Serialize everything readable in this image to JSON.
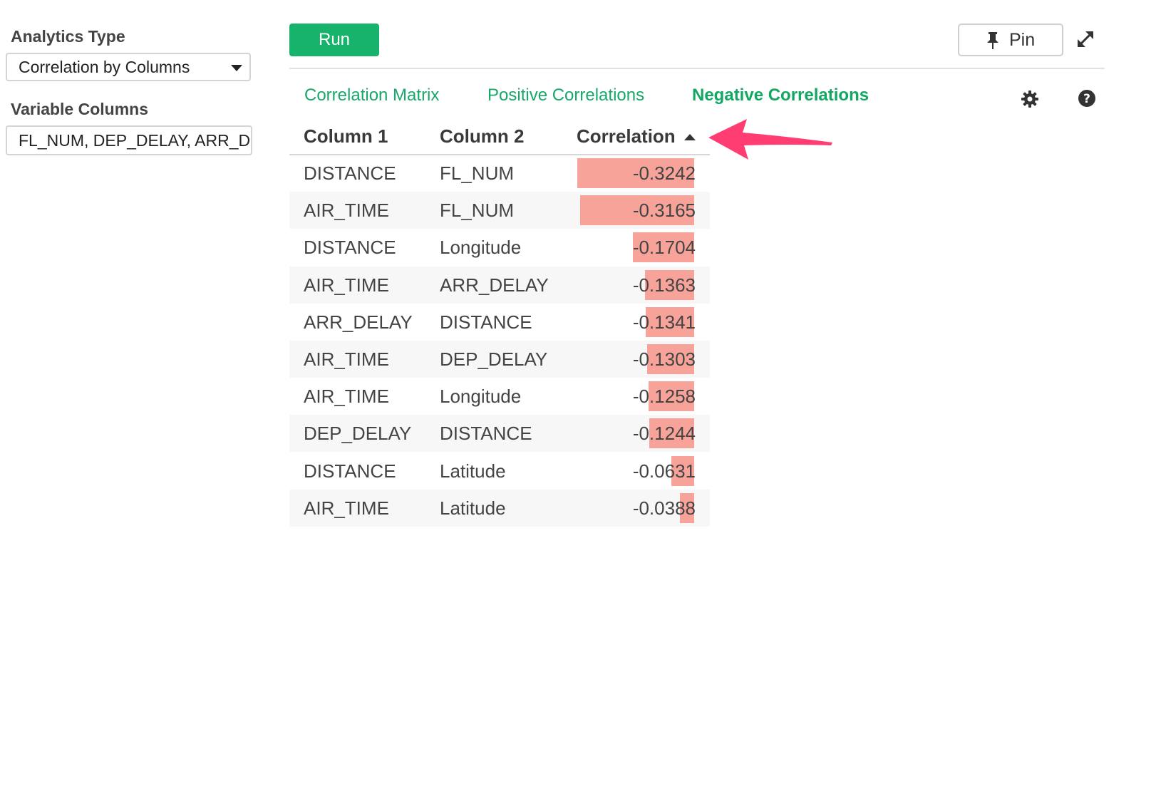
{
  "sidebar": {
    "analytics_type_label": "Analytics Type",
    "analytics_type_value": "Correlation by Columns",
    "variable_columns_label": "Variable Columns",
    "variable_columns_value": "FL_NUM, DEP_DELAY, ARR_DELAY"
  },
  "toolbar": {
    "run_label": "Run",
    "pin_label": "Pin"
  },
  "tabs": [
    {
      "label": "Correlation Matrix"
    },
    {
      "label": "Positive Correlations"
    },
    {
      "label": "Negative Correlations"
    }
  ],
  "active_tab": "Negative Correlations",
  "table": {
    "headers": [
      "Column 1",
      "Column 2",
      "Correlation"
    ],
    "sort": "ascending",
    "rows": [
      {
        "col1": "DISTANCE",
        "col2": "FL_NUM",
        "corr": "-0.3242",
        "value": -0.3242
      },
      {
        "col1": "AIR_TIME",
        "col2": "FL_NUM",
        "corr": "-0.3165",
        "value": -0.3165
      },
      {
        "col1": "DISTANCE",
        "col2": "Longitude",
        "corr": "-0.1704",
        "value": -0.1704
      },
      {
        "col1": "AIR_TIME",
        "col2": "ARR_DELAY",
        "corr": "-0.1363",
        "value": -0.1363
      },
      {
        "col1": "ARR_DELAY",
        "col2": "DISTANCE",
        "corr": "-0.1341",
        "value": -0.1341
      },
      {
        "col1": "AIR_TIME",
        "col2": "DEP_DELAY",
        "corr": "-0.1303",
        "value": -0.1303
      },
      {
        "col1": "AIR_TIME",
        "col2": "Longitude",
        "corr": "-0.1258",
        "value": -0.1258
      },
      {
        "col1": "DEP_DELAY",
        "col2": "DISTANCE",
        "corr": "-0.1244",
        "value": -0.1244
      },
      {
        "col1": "DISTANCE",
        "col2": "Latitude",
        "corr": "-0.0631",
        "value": -0.0631
      },
      {
        "col1": "AIR_TIME",
        "col2": "Latitude",
        "corr": "-0.0388",
        "value": -0.0388
      }
    ]
  },
  "colors": {
    "accent": "#17b26b",
    "bar": "#f7a39a",
    "annotation_arrow": "#ff3d73"
  },
  "icons": [
    "caret-down-icon",
    "pin-icon",
    "expand-icon",
    "gear-icon",
    "help-icon",
    "sort-up-icon",
    "arrow-annotation"
  ]
}
